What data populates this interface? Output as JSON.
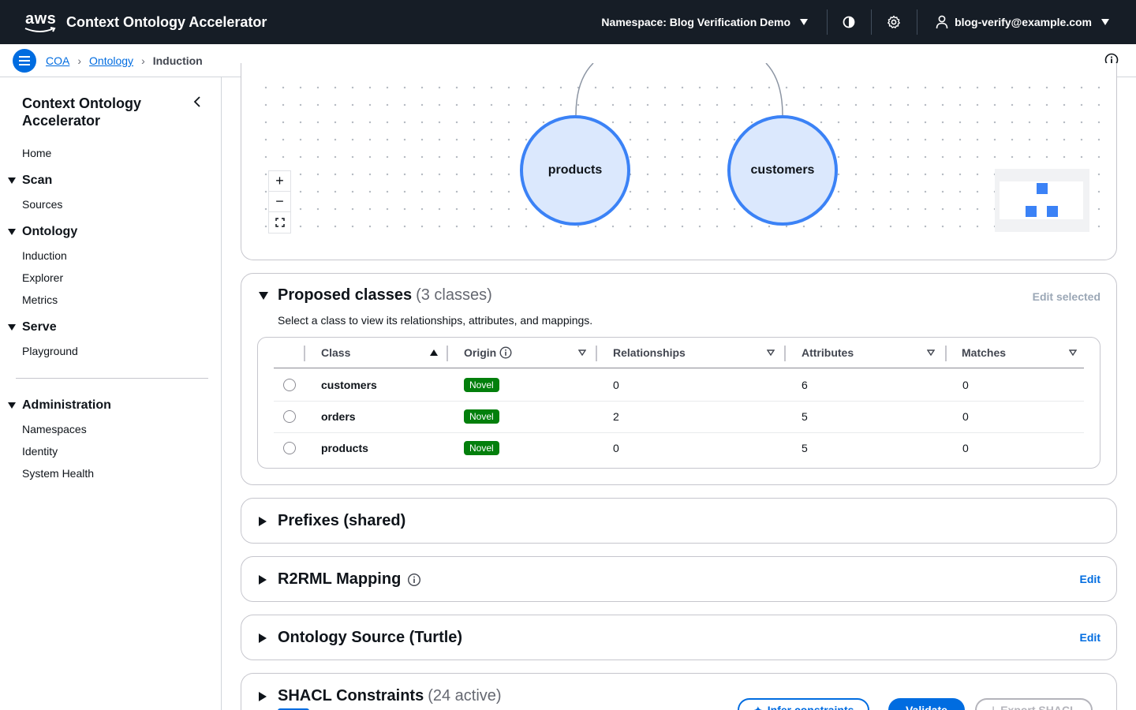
{
  "topnav": {
    "logo_text": "aws",
    "app_title": "Context Ontology Accelerator",
    "namespace_label": "Namespace: Blog Verification Demo",
    "user_email": "blog-verify@example.com",
    "icons": [
      "contrast-icon",
      "gear-icon",
      "user-icon",
      "caret-down-icon"
    ]
  },
  "breadcrumb": {
    "items": [
      "COA",
      "Ontology"
    ],
    "current": "Induction"
  },
  "sidebar": {
    "title": "Context Ontology Accelerator",
    "home": "Home",
    "sections": [
      {
        "label": "Scan",
        "items": [
          "Sources"
        ]
      },
      {
        "label": "Ontology",
        "items": [
          "Induction",
          "Explorer",
          "Metrics"
        ]
      },
      {
        "label": "Serve",
        "items": [
          "Playground"
        ]
      },
      {
        "label": "Administration",
        "items": [
          "Namespaces",
          "Identity",
          "System Health"
        ]
      }
    ]
  },
  "graph": {
    "nodes": [
      "products",
      "customers"
    ],
    "zoom_controls": [
      "+",
      "−"
    ]
  },
  "proposed_classes": {
    "title": "Proposed classes",
    "count": "(3 classes)",
    "edit_selected": "Edit selected",
    "description": "Select a class to view its relationships, attributes, and mappings.",
    "columns": [
      "Class",
      "Origin",
      "Relationships",
      "Attributes",
      "Matches"
    ],
    "rows": [
      {
        "class": "customers",
        "origin": "Novel",
        "relationships": "0",
        "attributes": "6",
        "matches": "0"
      },
      {
        "class": "orders",
        "origin": "Novel",
        "relationships": "2",
        "attributes": "5",
        "matches": "0"
      },
      {
        "class": "products",
        "origin": "Novel",
        "relationships": "0",
        "attributes": "5",
        "matches": "0"
      }
    ]
  },
  "sections": {
    "prefixes": "Prefixes (shared)",
    "r2rml": "R2RML Mapping",
    "r2rml_edit": "Edit",
    "turtle": "Ontology Source (Turtle)",
    "turtle_edit": "Edit",
    "shacl": "SHACL Constraints",
    "shacl_count": "(24 active)",
    "shacl_buttons": [
      "Infer constraints",
      "Validate",
      "Export SHACL"
    ]
  },
  "colors": {
    "nav_bg": "#161d26",
    "accent": "#006ce0",
    "badge_green": "#037f0c",
    "node_fill": "#dbe8fd",
    "node_stroke": "#3b82f6"
  }
}
